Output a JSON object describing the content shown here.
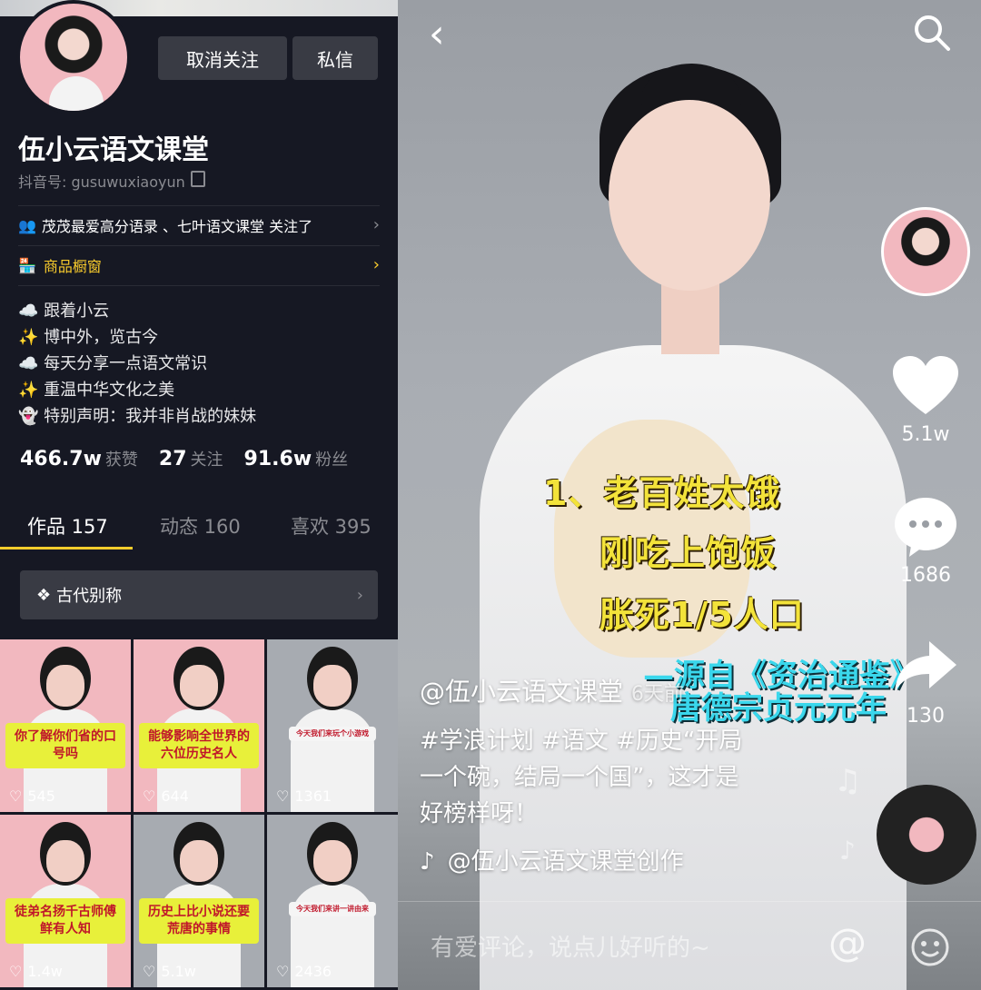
{
  "profile": {
    "unfollow_label": "取消关注",
    "message_label": "私信",
    "name": "伍小云语文课堂",
    "douyin_id": "抖音号: gusuwuxiaoyun",
    "followed_by": "茂茂最爱高分语录 、七叶语文课堂 关注了",
    "shop": "商品橱窗",
    "bio": [
      "☁️ 跟着小云",
      "✨ 博中外，览古今",
      "☁️ 每天分享一点语文常识",
      "✨ 重温中华文化之美",
      "👻 特别声明：我并非肖战的妹妹"
    ],
    "stats": [
      {
        "value": "466.7w",
        "label": "获赞"
      },
      {
        "value": "27",
        "label": "关注"
      },
      {
        "value": "91.6w",
        "label": "粉丝"
      }
    ],
    "tabs": [
      {
        "label": "作品 157"
      },
      {
        "label": "动态 160"
      },
      {
        "label": "喜欢 395"
      }
    ],
    "collection": "古代别称",
    "videos": [
      {
        "caption": "你了解你们省的口号吗",
        "likes": "545",
        "bg": "#f2b8bf"
      },
      {
        "caption": "能够影响全世界的六位历史名人",
        "likes": "644",
        "bg": "#f2b8bf"
      },
      {
        "caption": "今天我们来玩个小游戏",
        "likes": "1361",
        "bg": "#a7abb1"
      },
      {
        "caption": "徒弟名扬千古师傅鲜有人知",
        "likes": "1.4w",
        "bg": "#f2b8bf"
      },
      {
        "caption": "历史上比小说还要荒唐的事情",
        "likes": "5.1w",
        "bg": "#a7abb1"
      },
      {
        "caption": "今天我们来讲一讲由来",
        "likes": "2436",
        "bg": "#a7abb1"
      }
    ]
  },
  "video": {
    "caption_lines": [
      "1、老百姓太饿",
      "刚吃上饱饭",
      "胀死1/5人口"
    ],
    "source_line1": "—源自《资治通鉴》",
    "source_line2": "唐德宗贞元元年",
    "author": "@伍小云语文课堂",
    "time": "6天前",
    "desc_line1": "#学浪计划 #语文 #历史“开局",
    "desc_line2": "一个碗，结局一个国”，这才是",
    "desc_line3": "好榜样呀！",
    "music": "@伍小云语文课堂创作",
    "likes": "5.1w",
    "comments": "1686",
    "shares": "130",
    "comment_placeholder": "有爱评论，说点儿好听的~"
  },
  "colors": {
    "accent": "#fbcd2c",
    "bg": "#161823",
    "plus": "#fe2c55"
  }
}
